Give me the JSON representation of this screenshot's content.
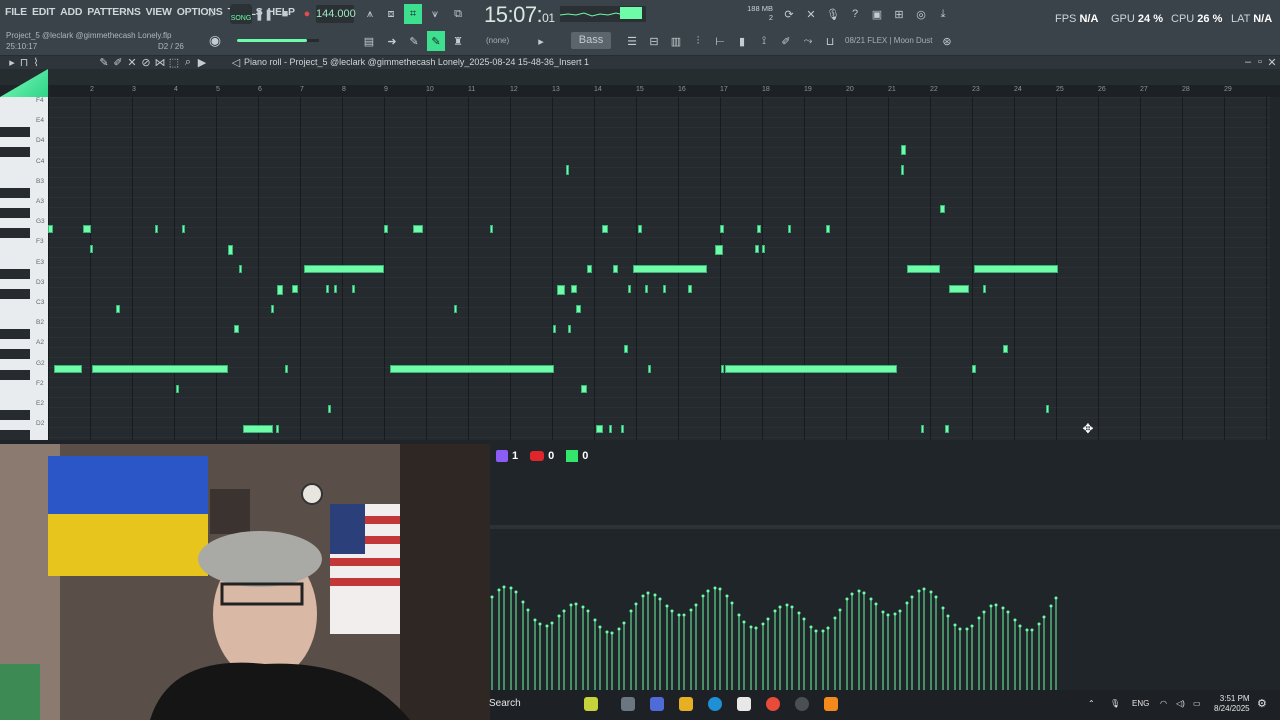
{
  "menu": [
    "FILE",
    "EDIT",
    "ADD",
    "PATTERNS",
    "VIEW",
    "OPTIONS",
    "TOOLS",
    "HELP"
  ],
  "project": {
    "name": "Project_5 @leclark @gimmethecash Lonely.flp",
    "elapsed": "25:10:17",
    "pattern_count": "D2 / 26"
  },
  "transport": {
    "mode": "SONG",
    "tempo": "144.000",
    "time_main": "15:07:",
    "time_sub": "01"
  },
  "memory": {
    "mb": "188 MB",
    "voices": "2"
  },
  "stats": {
    "fps_label": "FPS",
    "fps": "N/A",
    "gpu_label": "GPU",
    "gpu": "24 %",
    "cpu_label": "CPU",
    "cpu": "26 %",
    "lat_label": "LAT",
    "lat": "N/A"
  },
  "channel": {
    "none": "(none)",
    "bass": "Bass",
    "plugin": "08/21 FLEX | Moon Dust"
  },
  "piano_roll": {
    "title": "Piano roll - Project_5 @leclark @gimmethecash Lonely_2025-08-24 15-48-36_Insert 1"
  },
  "ruler": [
    "2",
    "3",
    "4",
    "5",
    "6",
    "7",
    "8",
    "9",
    "10",
    "11",
    "12",
    "13",
    "14",
    "15",
    "16",
    "17",
    "18",
    "19",
    "20",
    "21",
    "22",
    "23",
    "24",
    "25",
    "26",
    "27",
    "28",
    "29"
  ],
  "keys": [
    "F4",
    "E4",
    "D4",
    "C4",
    "B3",
    "A3",
    "G3",
    "F3",
    "E3",
    "D3",
    "C3",
    "B2",
    "A2",
    "G2",
    "F2",
    "E2",
    "D2"
  ],
  "chat": {
    "twitch": "1",
    "youtube": "0",
    "kick": "0"
  },
  "taskbar": {
    "search": "Search",
    "lang": "ENG",
    "time": "3:51 PM",
    "date": "8/24/2025"
  },
  "colors": {
    "note": "#6efca8",
    "accent": "#3ce08f"
  }
}
